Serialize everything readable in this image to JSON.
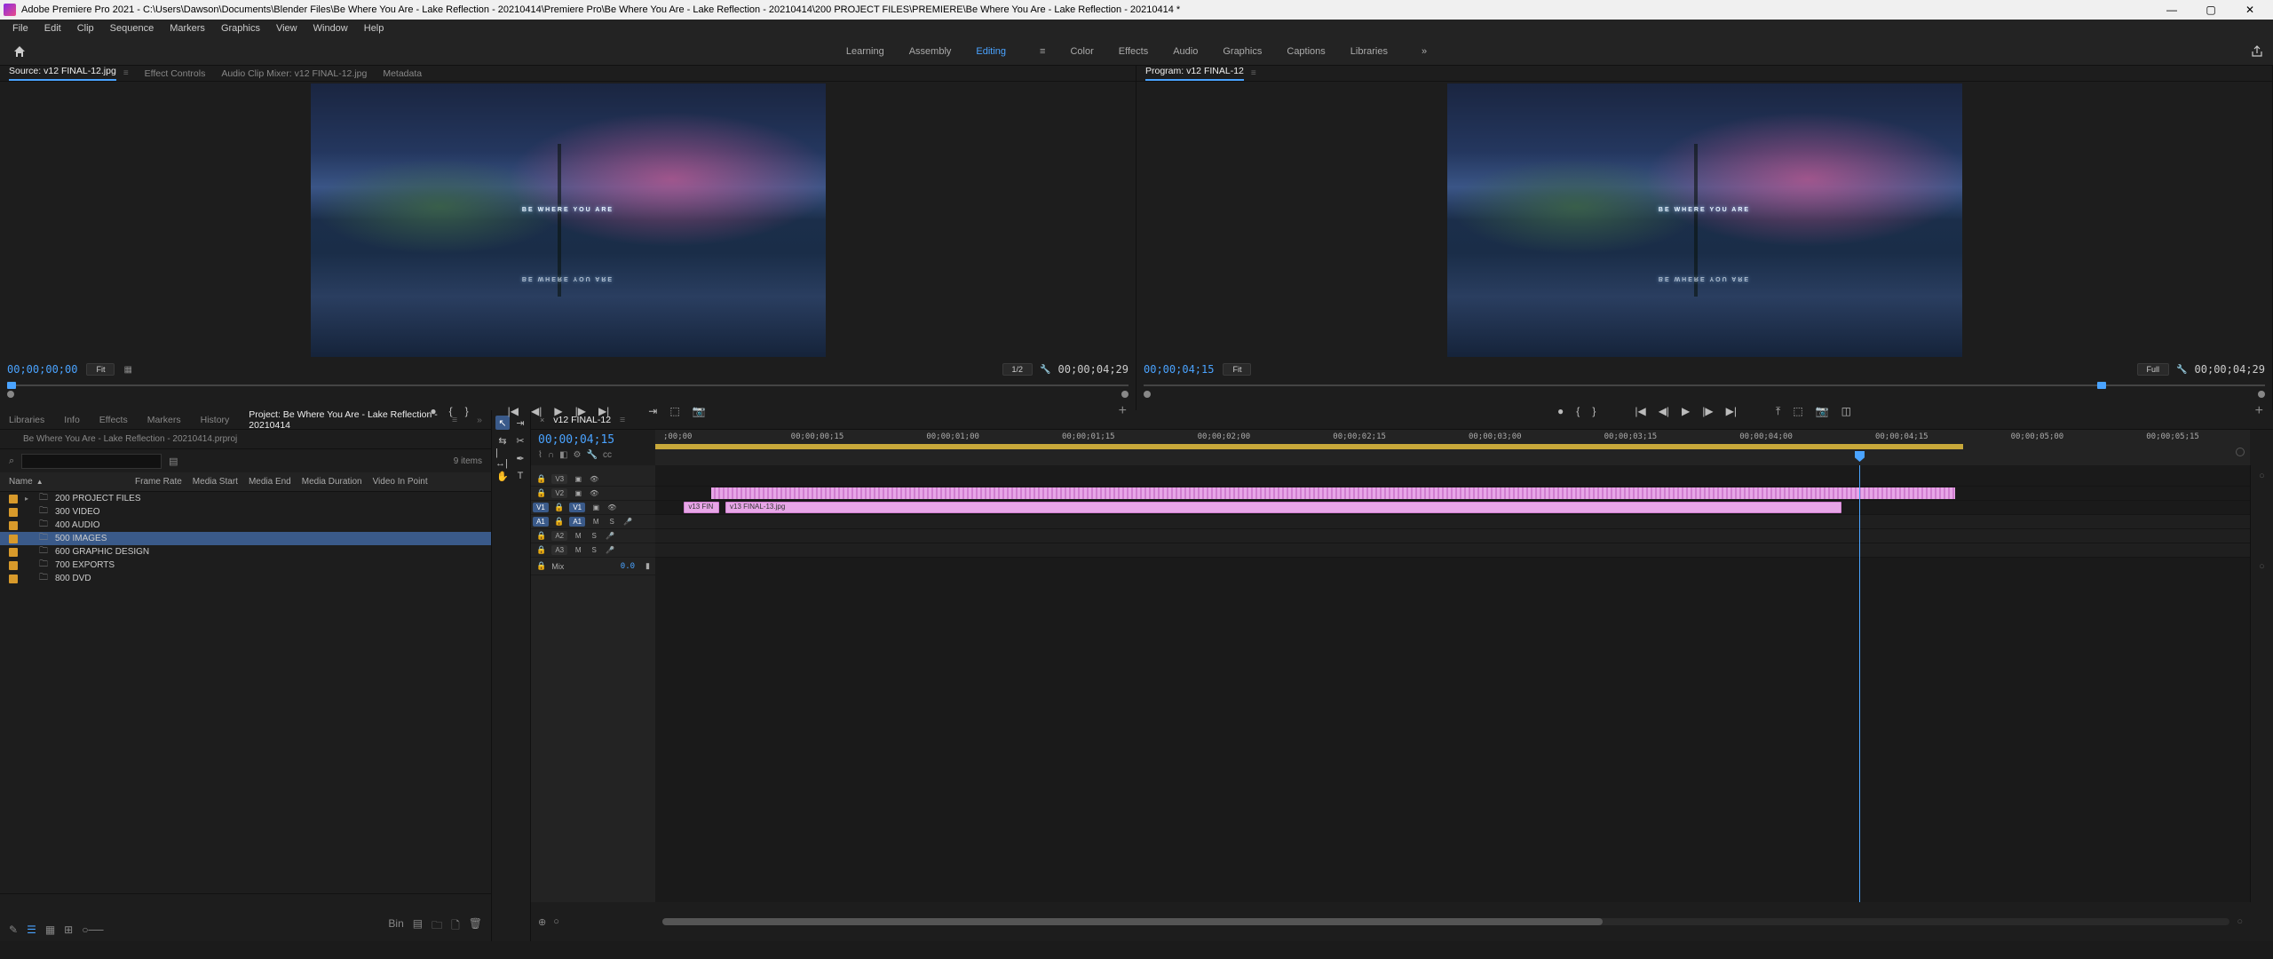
{
  "title": "Adobe Premiere Pro 2021 - C:\\Users\\Dawson\\Documents\\Blender Files\\Be Where You Are - Lake Reflection - 20210414\\Premiere Pro\\Be Where You Are - Lake Reflection - 20210414\\200 PROJECT FILES\\PREMIERE\\Be Where You Are - Lake Reflection - 20210414 *",
  "menu": {
    "file": "File",
    "edit": "Edit",
    "clip": "Clip",
    "sequence": "Sequence",
    "markers": "Markers",
    "graphics": "Graphics",
    "view": "View",
    "window": "Window",
    "help": "Help"
  },
  "workspaces": {
    "learning": "Learning",
    "assembly": "Assembly",
    "editing": "Editing",
    "color": "Color",
    "effects": "Effects",
    "audio": "Audio",
    "graphics": "Graphics",
    "captions": "Captions",
    "libraries": "Libraries"
  },
  "source": {
    "tabs": {
      "source": "Source: v12 FINAL-12.jpg",
      "effect": "Effect Controls",
      "audio": "Audio Clip Mixer: v12 FINAL-12.jpg",
      "metadata": "Metadata"
    },
    "overlay1": "BE WHERE YOU ARE",
    "overlay2": "BE WHERE YOU ARE",
    "tc": "00;00;00;00",
    "fit": "Fit",
    "frac": "1/2",
    "dur": "00;00;04;29"
  },
  "program": {
    "tab": "Program: v12 FINAL-12",
    "overlay1": "BE WHERE YOU ARE",
    "overlay2": "BE WHERE YOU ARE",
    "tc": "00;00;04;15",
    "fit": "Fit",
    "full": "Full",
    "dur": "00;00;04;29"
  },
  "project": {
    "tabs": {
      "libraries": "Libraries",
      "info": "Info",
      "effects": "Effects",
      "markers": "Markers",
      "history": "History",
      "project": "Project: Be Where You Are - Lake Reflection - 20210414"
    },
    "subtitle": "Be Where You Are - Lake Reflection - 20210414.prproj",
    "searchPlaceholder": "",
    "items": "9 items",
    "cols": {
      "name": "Name",
      "frameRate": "Frame Rate",
      "mediaStart": "Media Start",
      "mediaEnd": "Media End",
      "mediaDuration": "Media Duration",
      "videoIn": "Video In Point"
    },
    "rows": [
      "200 PROJECT FILES",
      "300 VIDEO",
      "400 AUDIO",
      "500 IMAGES",
      "600 GRAPHIC DESIGN",
      "700 EXPORTS",
      "800 DVD"
    ],
    "footer": {
      "bin": "Bin"
    }
  },
  "timeline": {
    "tab": "v12 FINAL-12",
    "tc": "00;00;04;15",
    "ticks": [
      ";00;00",
      "00;00;00;15",
      "00;00;01;00",
      "00;00;01;15",
      "00;00;02;00",
      "00;00;02;15",
      "00;00;03;00",
      "00;00;03;15",
      "00;00;04;00",
      "00;00;04;15",
      "00;00;05;00",
      "00;00;05;15"
    ],
    "vtracks": [
      {
        "lbl": "V3"
      },
      {
        "lbl": "V2"
      },
      {
        "lbl": "V1"
      }
    ],
    "atracks": [
      {
        "lbl": "A1"
      },
      {
        "lbl": "A2"
      },
      {
        "lbl": "A3"
      }
    ],
    "srcV": "V1",
    "srcA": "A1",
    "mix": {
      "lbl": "Mix",
      "val": "0.0"
    },
    "clip1": "v13 FIN",
    "clip2": "v13 FINAL-13.jpg",
    "btns": {
      "m": "M",
      "s": "S"
    }
  }
}
